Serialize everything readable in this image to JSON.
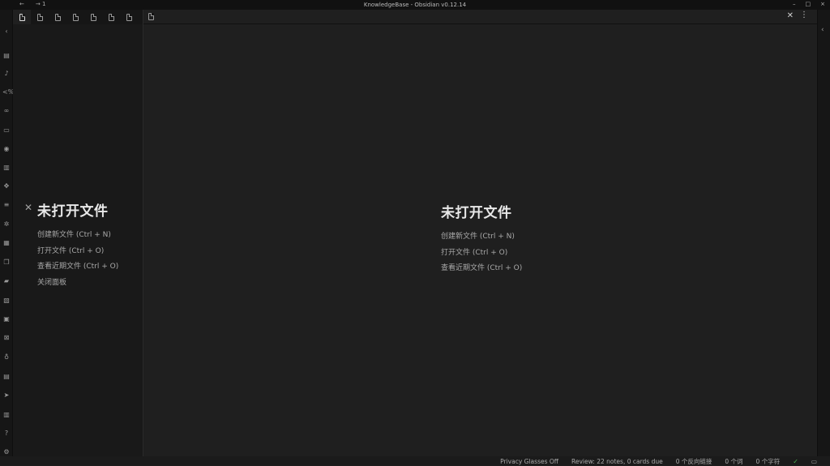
{
  "titlebar": {
    "back": "←",
    "forward": "→ 1",
    "title": "KnowledgeBase - Obsidian v0.12.14",
    "minimize": "–",
    "maximize": "□",
    "close": "×"
  },
  "ribbon": {
    "collapse": "‹",
    "icons": [
      {
        "name": "table-icon",
        "glyph": "▤"
      },
      {
        "name": "microphone-icon",
        "glyph": "♪"
      },
      {
        "name": "template-icon",
        "glyph": "<%"
      },
      {
        "name": "glasses-icon",
        "glyph": "∞"
      },
      {
        "name": "archive-icon",
        "glyph": "▭"
      },
      {
        "name": "map-pin-icon",
        "glyph": "◉"
      },
      {
        "name": "database-icon",
        "glyph": "▥"
      },
      {
        "name": "move-icon",
        "glyph": "✥"
      },
      {
        "name": "document-list-icon",
        "glyph": "≡"
      },
      {
        "name": "graph-icon",
        "glyph": "✲"
      },
      {
        "name": "calendar-icon",
        "glyph": "▦"
      },
      {
        "name": "copy-icon",
        "glyph": "❐"
      },
      {
        "name": "cards-icon",
        "glyph": "▰"
      },
      {
        "name": "layers-icon",
        "glyph": "▧"
      },
      {
        "name": "inbox-icon",
        "glyph": "▣"
      },
      {
        "name": "dice-icon",
        "glyph": "⊠"
      },
      {
        "name": "mic-icon",
        "glyph": "♁"
      },
      {
        "name": "checklist-icon",
        "glyph": "▤"
      },
      {
        "name": "send-icon",
        "glyph": "➤"
      },
      {
        "name": "book-icon",
        "glyph": "▥"
      },
      {
        "name": "help-icon",
        "glyph": "?"
      },
      {
        "name": "settings-icon",
        "glyph": "⚙"
      }
    ]
  },
  "left_empty": {
    "heading": "未打开文件",
    "actions": [
      "创建新文件 (Ctrl + N)",
      "打开文件 (Ctrl + O)",
      "查看近期文件 (Ctrl + O)",
      "关闭面板"
    ],
    "close_glyph": "✕"
  },
  "main_empty": {
    "heading": "未打开文件",
    "actions": [
      "创建新文件 (Ctrl + N)",
      "打开文件 (Ctrl + O)",
      "查看近期文件 (Ctrl + O)"
    ]
  },
  "main_tabbar": {
    "close_glyph": "✕",
    "more_glyph": "⋮"
  },
  "right_strip": {
    "expand": "‹"
  },
  "statusbar": {
    "privacy": "Privacy Glasses Off",
    "review": "Review: 22 notes, 0 cards due",
    "backlinks": "0 个反向链接",
    "words": "0 个词",
    "chars": "0 个字符",
    "sync_glyph": "✓",
    "layout_glyph": "▭"
  },
  "colors": {
    "background": "#1e1e1e",
    "sidebar": "#191919",
    "accent_ok": "#4caf50"
  }
}
